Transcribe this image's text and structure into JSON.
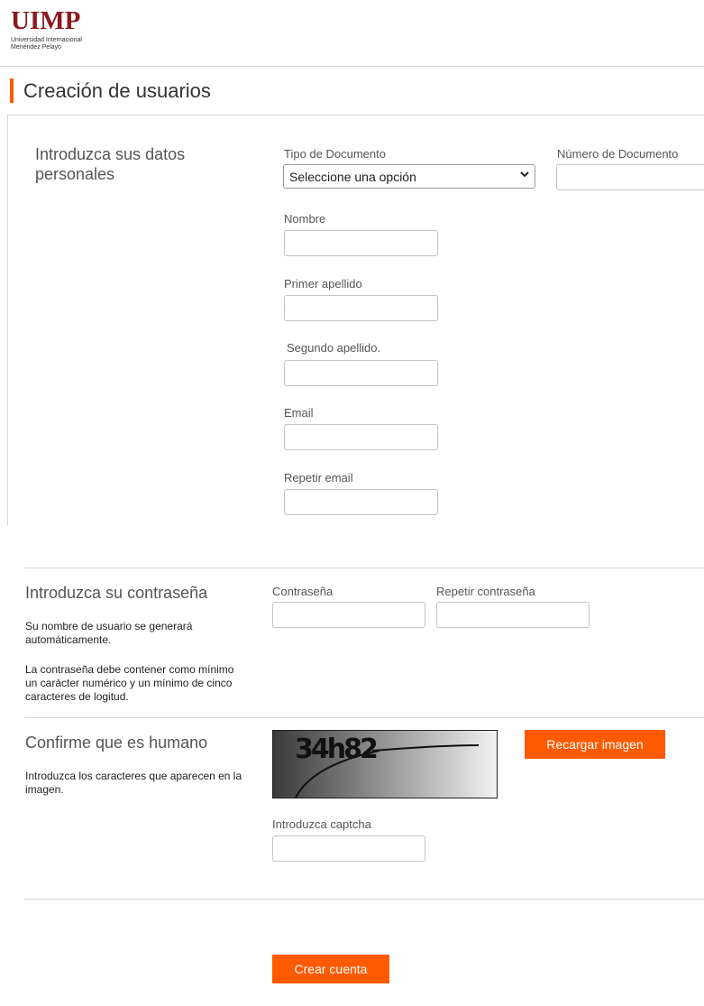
{
  "logo": {
    "text": "UIMP",
    "subtitle_line1": "Universidad Internacional",
    "subtitle_line2": "Menéndez Pelayo"
  },
  "page": {
    "title": "Creación de usuarios"
  },
  "personal": {
    "heading": "Introduzca sus datos personales",
    "doc_type_label": "Tipo de Documento",
    "doc_type_value": "Seleccione una opción",
    "doc_number_label": "Número de Documento",
    "name_label": "Nombre",
    "first_surname_label": "Primer apellido",
    "second_surname_label": "Segundo apellido.",
    "email_label": "Email",
    "repeat_email_label": "Repetir email"
  },
  "password": {
    "heading": "Introduzca su contraseña",
    "note1": "Su nombre de usuario se generará automáticamente.",
    "note2": "La contraseña debe contener como mínimo un carácter numérico y un mínimo de cinco caracteres de logitud.",
    "password_label": "Contraseña",
    "repeat_password_label": "Repetir contraseña"
  },
  "human": {
    "heading": "Confirme que es humano",
    "note": "Introduzca los caracteres que aparecen en la imagen.",
    "captcha_text": "34h82",
    "reload_button": "Recargar imagen",
    "captcha_label": "Introduzca captcha"
  },
  "actions": {
    "create_button": "Crear cuenta"
  },
  "colors": {
    "accent": "#ff5a00",
    "brand": "#8a1a1e"
  }
}
